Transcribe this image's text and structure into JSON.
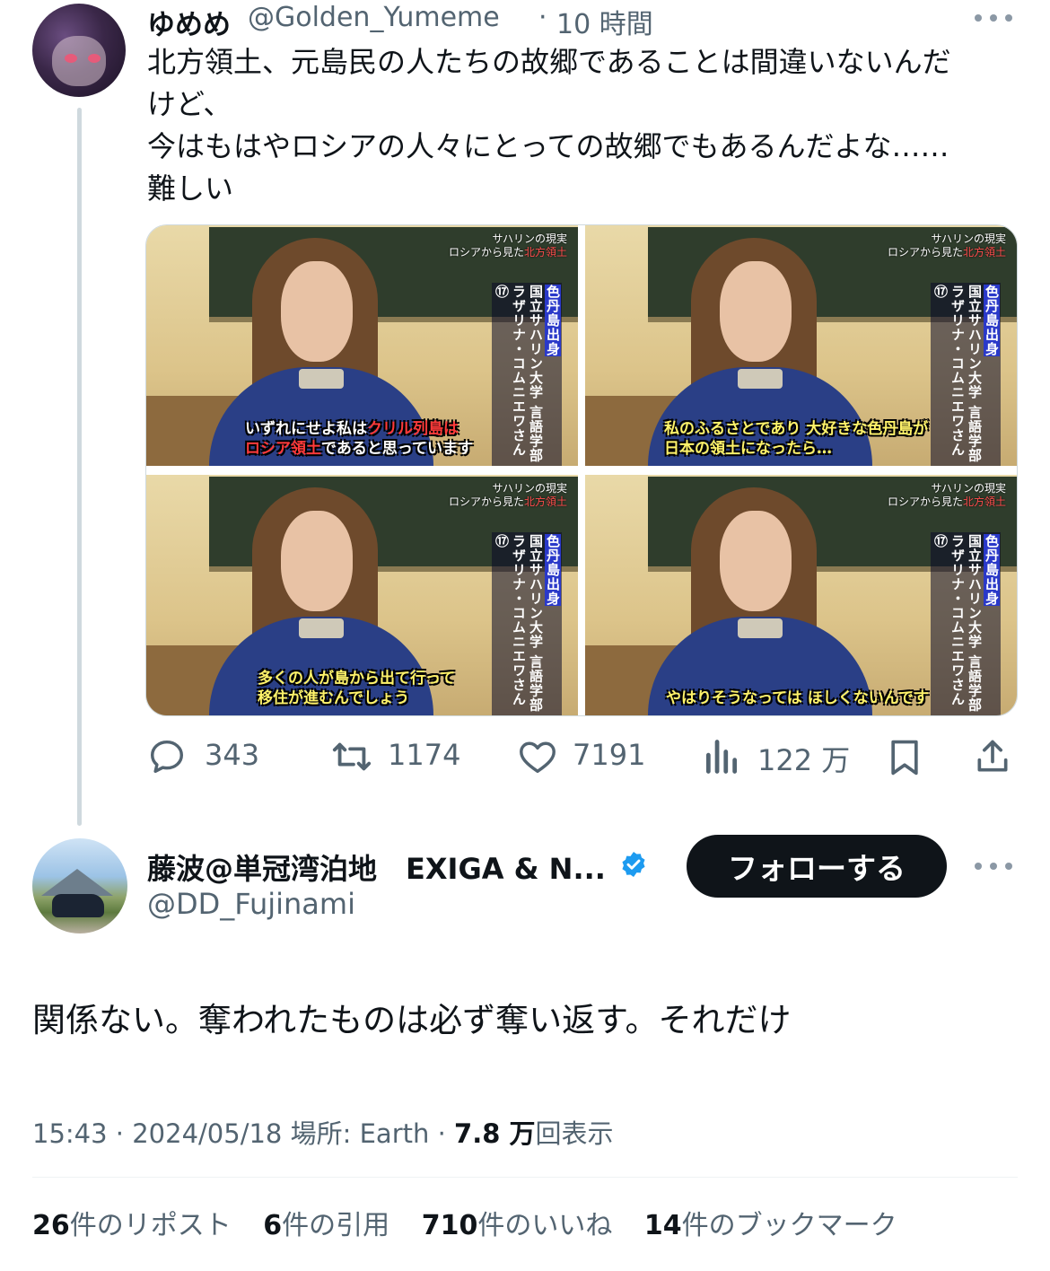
{
  "parent_tweet": {
    "display_name": "ゆめめ",
    "handle": "@Golden_Yumeme",
    "separator": "·",
    "time": "10 時間",
    "text": "北方領土、元島民の人たちの故郷であることは間違いないんだ\nけど、\n今はもはやロシアの人々にとっての故郷でもあるんだよな……\n難しい",
    "media": [
      {
        "program_title_1": "サハリンの現実",
        "program_title_2a": "ロシアから見た",
        "program_title_2b": "北方領土",
        "person_origin": "色丹島出身",
        "person_affiliation": "国立サハリン大学 言語学部",
        "person_name": "ラザリナ・コムニエワさん⑰",
        "subtitle_line1_a": "いずれにせよ私は",
        "subtitle_line1_b": "クリル列島は",
        "subtitle_line2_a": "ロシア領土",
        "subtitle_line2_b": "であると思っています"
      },
      {
        "program_title_1": "サハリンの現実",
        "program_title_2a": "ロシアから見た",
        "program_title_2b": "北方領土",
        "person_origin": "色丹島出身",
        "person_affiliation": "国立サハリン大学 言語学部",
        "person_name": "ラザリナ・コムニエワさん⑰",
        "subtitle_line1": "私のふるさとであり 大好きな色丹島が",
        "subtitle_line2": "日本の領土になったら…"
      },
      {
        "program_title_1": "サハリンの現実",
        "program_title_2a": "ロシアから見た",
        "program_title_2b": "北方領土",
        "person_origin": "色丹島出身",
        "person_affiliation": "国立サハリン大学 言語学部",
        "person_name": "ラザリナ・コムニエワさん⑰",
        "subtitle_line1": "多くの人が島から出て行って",
        "subtitle_line2": "移住が進むんでしょう"
      },
      {
        "program_title_1": "サハリンの現実",
        "program_title_2a": "ロシアから見た",
        "program_title_2b": "北方領土",
        "person_origin": "色丹島出身",
        "person_affiliation": "国立サハリン大学 言語学部",
        "person_name": "ラザリナ・コムニエワさん⑰",
        "subtitle_line1": "やはりそうなっては ほしくないんです"
      }
    ],
    "actions": {
      "replies": "343",
      "retweets": "1174",
      "likes": "7191",
      "views": "122 万"
    }
  },
  "reply_tweet": {
    "display_name": "藤波@単冠湾泊地　EXIGA & N...",
    "handle": "@DD_Fujinami",
    "follow_label": "フォローする",
    "text": "関係ない。奪われたものは必ず奪い返す。それだけ",
    "meta": {
      "time": "15:43",
      "sep1": "·",
      "date": "2024/05/18",
      "location": "場所: Earth",
      "sep2": "·",
      "views_count": "7.8 万",
      "views_label": "回表示"
    },
    "stats": [
      {
        "count": "26",
        "label": "件のリポスト"
      },
      {
        "count": "6",
        "label": "件の引用"
      },
      {
        "count": "710",
        "label": "件のいいね"
      },
      {
        "count": "14",
        "label": "件のブックマーク"
      }
    ]
  },
  "colors": {
    "text_primary": "#0f1419",
    "text_secondary": "#536471",
    "verified_blue": "#1d9bf0",
    "follow_button_bg": "#0f1419"
  },
  "icons": [
    "more-icon",
    "reply-icon",
    "retweet-icon",
    "like-icon",
    "views-icon",
    "bookmark-icon",
    "share-icon",
    "verified-icon"
  ]
}
